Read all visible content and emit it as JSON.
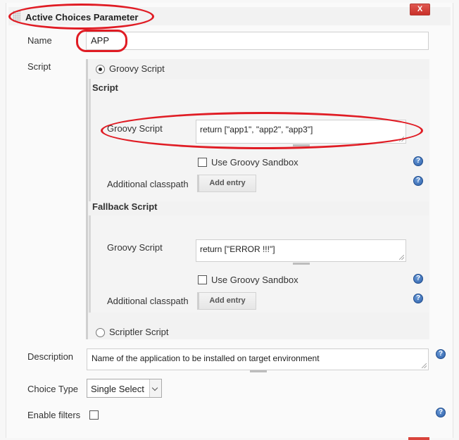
{
  "header": {
    "title": "Active Choices Parameter",
    "close_label": "X"
  },
  "name_field": {
    "label": "Name",
    "value": "APP"
  },
  "script": {
    "label": "Script",
    "groovy_option_label": "Groovy Script",
    "script_section_title": "Script",
    "primary": {
      "groovy_label": "Groovy Script",
      "code": "return [\"app1\", \"app2\", \"app3\"]",
      "sandbox_label": "Use Groovy Sandbox",
      "classpath_label": "Additional classpath",
      "add_entry_label": "Add entry"
    },
    "fallback_title": "Fallback Script",
    "fallback": {
      "groovy_label": "Groovy Script",
      "code": "return [\"ERROR !!!\"]",
      "sandbox_label": "Use Groovy Sandbox",
      "classpath_label": "Additional classpath",
      "add_entry_label": "Add entry"
    },
    "scriptler_option_label": "Scriptler Script"
  },
  "description": {
    "label": "Description",
    "value": "Name of the application to be installed on target environment"
  },
  "choice_type": {
    "label": "Choice Type",
    "selected": "Single Select"
  },
  "enable_filters": {
    "label": "Enable filters"
  },
  "icons": {
    "help": "help-icon",
    "drag": "drag-handle-icon"
  },
  "colors": {
    "annotation_red": "#e01c24",
    "close_button": "#c9302a",
    "help_blue": "#2d5fa8"
  }
}
